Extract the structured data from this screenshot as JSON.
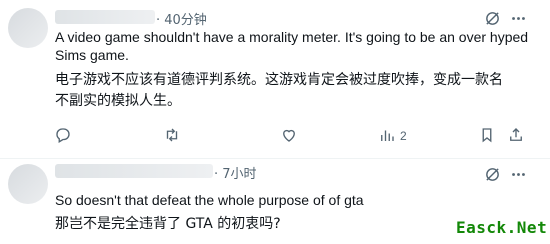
{
  "posts": [
    {
      "time": "40分钟",
      "text_en": "A video game shouldn't have a morality meter. It's going to be an over hyped Sims game.",
      "text_zh": "电子游戏不应该有道德评判系统。这游戏肯定会被过度吹捧，变成一款名不副实的模拟人生。",
      "views": "2"
    },
    {
      "time": "7小时",
      "text_en": "So doesn't that defeat the whole purpose of of gta",
      "text_zh": "那岂不是完全违背了 GTA 的初衷吗?"
    }
  ],
  "watermark": "Easck.Net",
  "icons": {
    "reply": "reply-icon",
    "repost": "repost-icon",
    "like": "like-icon",
    "views": "views-icon",
    "bookmark": "bookmark-icon",
    "share": "share-icon",
    "grok": "grok-icon",
    "more": "more-icon"
  },
  "colors": {
    "text": "#0f1419",
    "muted": "#536471",
    "watermark": "#138808"
  }
}
